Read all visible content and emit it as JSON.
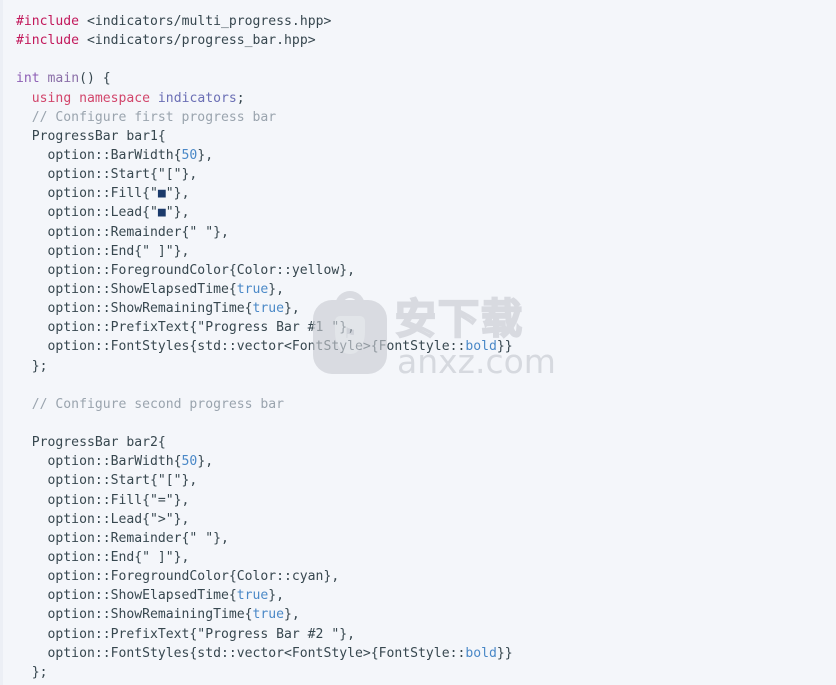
{
  "document": {
    "type": "source-code",
    "language": "C++",
    "background_color": "#f4f6fa",
    "text_color": "#37474f"
  },
  "colors": {
    "preprocessor": "#c2185b",
    "keyword": "#d2456b",
    "type": "#8e5fb5",
    "namespace": "#6b6fb5",
    "comment": "#9aa4ae",
    "number": "#4a88c7",
    "boolean": "#4a88c7",
    "plain": "#37474f",
    "square_glyph": "#1b3a6b",
    "background": "#f4f6fa"
  },
  "code": {
    "lines": [
      {
        "id": 1,
        "tokens": [
          {
            "t": "#include",
            "c": "pre"
          },
          {
            "t": " ",
            "c": "plain"
          },
          {
            "t": "<indicators/multi_progress.hpp>",
            "c": "header"
          }
        ]
      },
      {
        "id": 2,
        "tokens": [
          {
            "t": "#include",
            "c": "pre"
          },
          {
            "t": " ",
            "c": "plain"
          },
          {
            "t": "<indicators/progress_bar.hpp>",
            "c": "header"
          }
        ]
      },
      {
        "id": 3,
        "tokens": []
      },
      {
        "id": 4,
        "tokens": [
          {
            "t": "int",
            "c": "type"
          },
          {
            "t": " ",
            "c": "plain"
          },
          {
            "t": "main",
            "c": "fn"
          },
          {
            "t": "() {",
            "c": "plain"
          }
        ]
      },
      {
        "id": 5,
        "tokens": [
          {
            "t": "  ",
            "c": "plain"
          },
          {
            "t": "using namespace",
            "c": "kw"
          },
          {
            "t": " ",
            "c": "plain"
          },
          {
            "t": "indicators",
            "c": "ns"
          },
          {
            "t": ";",
            "c": "plain"
          }
        ]
      },
      {
        "id": 6,
        "tokens": [
          {
            "t": "  // Configure first progress bar",
            "c": "comment"
          }
        ]
      },
      {
        "id": 7,
        "tokens": [
          {
            "t": "  ProgressBar bar1{",
            "c": "plain"
          }
        ]
      },
      {
        "id": 8,
        "tokens": [
          {
            "t": "    option::BarWidth{",
            "c": "plain"
          },
          {
            "t": "50",
            "c": "num"
          },
          {
            "t": "},",
            "c": "plain"
          }
        ]
      },
      {
        "id": 9,
        "tokens": [
          {
            "t": "    option::Start{\"[\"},",
            "c": "plain"
          }
        ]
      },
      {
        "id": 10,
        "tokens": [
          {
            "t": "    option::Fill{\"",
            "c": "plain"
          },
          {
            "t": "■",
            "c": "sq"
          },
          {
            "t": "\"},",
            "c": "plain"
          }
        ]
      },
      {
        "id": 11,
        "tokens": [
          {
            "t": "    option::Lead{\"",
            "c": "plain"
          },
          {
            "t": "■",
            "c": "sq"
          },
          {
            "t": "\"},",
            "c": "plain"
          }
        ]
      },
      {
        "id": 12,
        "tokens": [
          {
            "t": "    option::Remainder{\" \"},",
            "c": "plain"
          }
        ]
      },
      {
        "id": 13,
        "tokens": [
          {
            "t": "    option::End{\" ]\"},",
            "c": "plain"
          }
        ]
      },
      {
        "id": 14,
        "tokens": [
          {
            "t": "    option::ForegroundColor{Color::yellow},",
            "c": "plain"
          }
        ]
      },
      {
        "id": 15,
        "tokens": [
          {
            "t": "    option::ShowElapsedTime{",
            "c": "plain"
          },
          {
            "t": "true",
            "c": "bool"
          },
          {
            "t": "},",
            "c": "plain"
          }
        ]
      },
      {
        "id": 16,
        "tokens": [
          {
            "t": "    option::ShowRemainingTime{",
            "c": "plain"
          },
          {
            "t": "true",
            "c": "bool"
          },
          {
            "t": "},",
            "c": "plain"
          }
        ]
      },
      {
        "id": 17,
        "tokens": [
          {
            "t": "    option::PrefixText{\"Progress Bar #1 \"},",
            "c": "plain"
          }
        ]
      },
      {
        "id": 18,
        "tokens": [
          {
            "t": "    option::FontStyles{std::vector<FontStyle>{FontStyle::",
            "c": "plain"
          },
          {
            "t": "bold",
            "c": "bool"
          },
          {
            "t": "}}",
            "c": "plain"
          }
        ]
      },
      {
        "id": 19,
        "tokens": [
          {
            "t": "  };",
            "c": "plain"
          }
        ]
      },
      {
        "id": 20,
        "tokens": []
      },
      {
        "id": 21,
        "tokens": [
          {
            "t": "  // Configure second progress bar",
            "c": "comment"
          }
        ]
      },
      {
        "id": 22,
        "tokens": []
      },
      {
        "id": 23,
        "tokens": [
          {
            "t": "  ProgressBar bar2{",
            "c": "plain"
          }
        ]
      },
      {
        "id": 24,
        "tokens": [
          {
            "t": "    option::BarWidth{",
            "c": "plain"
          },
          {
            "t": "50",
            "c": "num"
          },
          {
            "t": "},",
            "c": "plain"
          }
        ]
      },
      {
        "id": 25,
        "tokens": [
          {
            "t": "    option::Start{\"[\"},",
            "c": "plain"
          }
        ]
      },
      {
        "id": 26,
        "tokens": [
          {
            "t": "    option::Fill{\"=\"},",
            "c": "plain"
          }
        ]
      },
      {
        "id": 27,
        "tokens": [
          {
            "t": "    option::Lead{\">\"},",
            "c": "plain"
          }
        ]
      },
      {
        "id": 28,
        "tokens": [
          {
            "t": "    option::Remainder{\" \"},",
            "c": "plain"
          }
        ]
      },
      {
        "id": 29,
        "tokens": [
          {
            "t": "    option::End{\" ]\"},",
            "c": "plain"
          }
        ]
      },
      {
        "id": 30,
        "tokens": [
          {
            "t": "    option::ForegroundColor{Color::cyan},",
            "c": "plain"
          }
        ]
      },
      {
        "id": 31,
        "tokens": [
          {
            "t": "    option::ShowElapsedTime{",
            "c": "plain"
          },
          {
            "t": "true",
            "c": "bool"
          },
          {
            "t": "},",
            "c": "plain"
          }
        ]
      },
      {
        "id": 32,
        "tokens": [
          {
            "t": "    option::ShowRemainingTime{",
            "c": "plain"
          },
          {
            "t": "true",
            "c": "bool"
          },
          {
            "t": "},",
            "c": "plain"
          }
        ]
      },
      {
        "id": 33,
        "tokens": [
          {
            "t": "    option::PrefixText{\"Progress Bar #2 \"},",
            "c": "plain"
          }
        ]
      },
      {
        "id": 34,
        "tokens": [
          {
            "t": "    option::FontStyles{std::vector<FontStyle>{FontStyle::",
            "c": "plain"
          },
          {
            "t": "bold",
            "c": "bool"
          },
          {
            "t": "}}",
            "c": "plain"
          }
        ]
      },
      {
        "id": 35,
        "tokens": [
          {
            "t": "  };",
            "c": "plain"
          }
        ]
      }
    ]
  },
  "watermark": {
    "chinese_text": "安下载",
    "domain_text": "anxz.com",
    "badge_icon": "shield-bag-icon",
    "shield_mark": "⚑"
  }
}
